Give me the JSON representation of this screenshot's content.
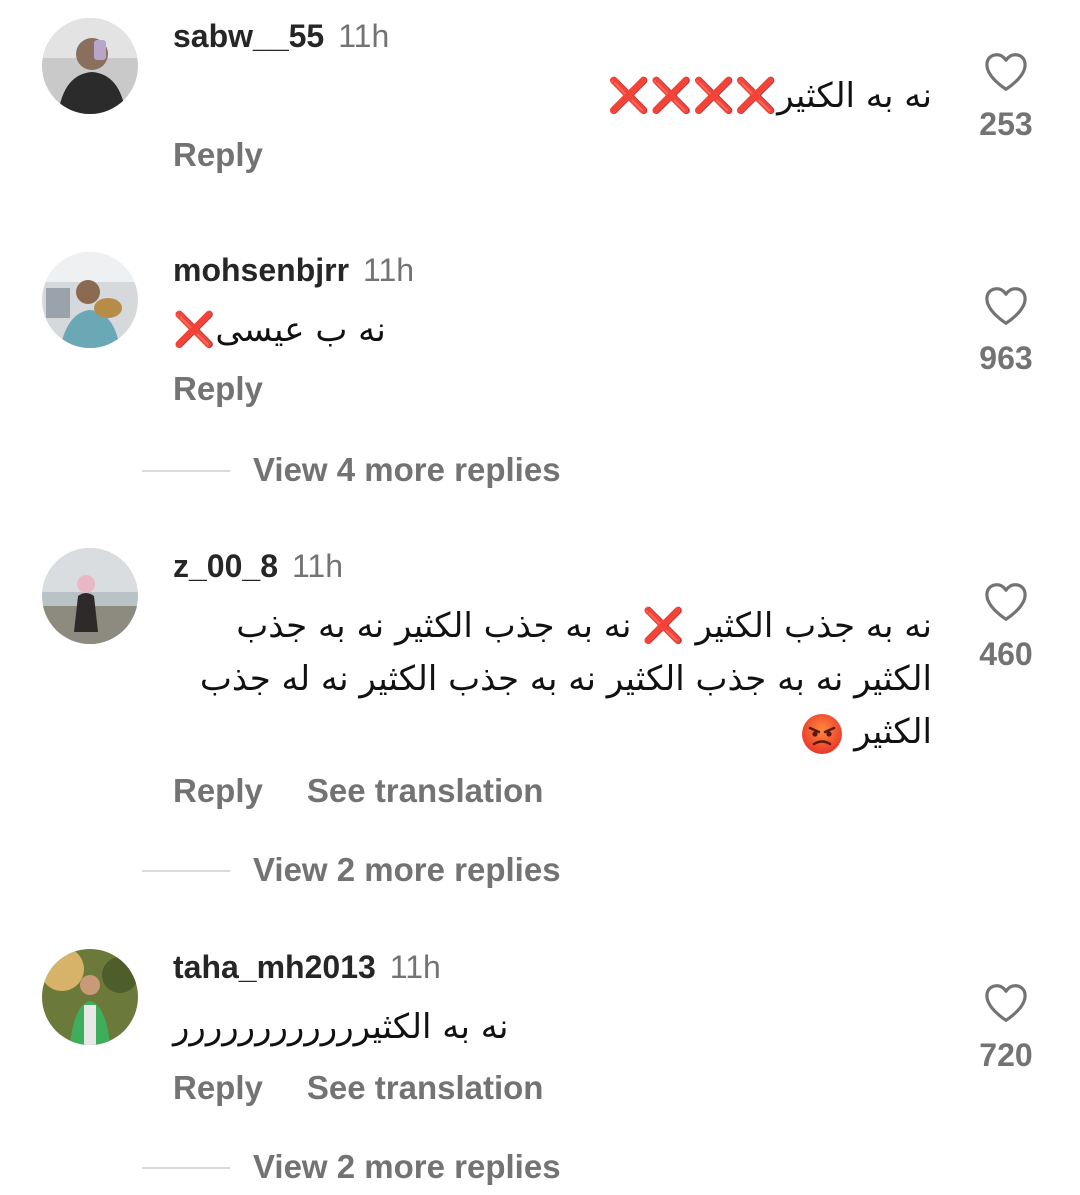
{
  "comments": [
    {
      "username": "sabw__55",
      "time": "11h",
      "text": "نه به الكثير",
      "marks": "❌❌❌❌",
      "likes": "253",
      "reply": "Reply"
    },
    {
      "username": "mohsenbjrr",
      "time": "11h",
      "text": "نه ب عیسی",
      "marks": "❌",
      "likes": "963",
      "reply": "Reply",
      "view_more": "View 4 more replies"
    },
    {
      "username": "z_00_8",
      "time": "11h",
      "text_a": "نه به جذب  الكثير",
      "marks": "❌",
      "text_b": "نه به جذب الكثير  نه به جذب الكثير  نه به جذب الكثير  نه به جذب الكثير  نه له جذب الكثير",
      "likes": "460",
      "reply": "Reply",
      "translate": "See translation",
      "view_more": "View 2 more replies"
    },
    {
      "username": "taha_mh2013",
      "time": "11h",
      "text": "نه به الكثيرررررررررررر",
      "likes": "720",
      "reply": "Reply",
      "translate": "See translation",
      "view_more": "View 2 more replies"
    }
  ],
  "colors": {
    "text": "#262626",
    "muted": "#737373",
    "xmark": "#e0212b",
    "divider": "#dbdbdb"
  },
  "icons": {
    "like": "heart-outline-icon",
    "emoji": "angry-face-emoji"
  }
}
